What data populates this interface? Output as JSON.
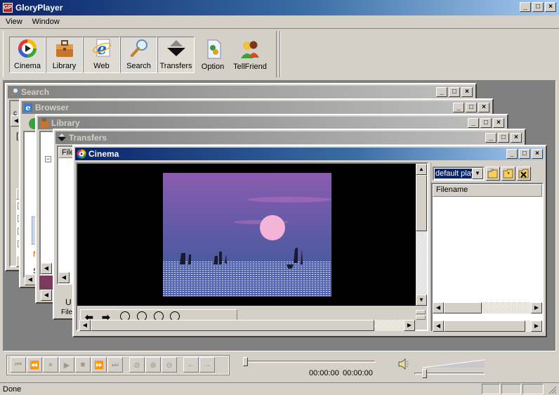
{
  "app": {
    "title": "GloryPlayer",
    "window_controls": {
      "minimize": "_",
      "maximize": "□",
      "close": "×"
    }
  },
  "menu": {
    "items": [
      {
        "label": "View",
        "accel": "V"
      },
      {
        "label": "Window",
        "accel": "W"
      }
    ]
  },
  "toolbar": {
    "buttons": [
      {
        "label": "Cinema",
        "icon": "cinema-icon",
        "pressed": true
      },
      {
        "label": "Library",
        "icon": "briefcase-icon",
        "pressed": true
      },
      {
        "label": "Web",
        "icon": "ie-icon",
        "pressed": true
      },
      {
        "label": "Search",
        "icon": "magnifier-icon",
        "pressed": true
      },
      {
        "label": "Transfers",
        "icon": "transfers-icon",
        "pressed": true
      },
      {
        "label": "Option",
        "icon": "option-icon",
        "pressed": false
      },
      {
        "label": "TellFriend",
        "icon": "users-icon",
        "pressed": false
      }
    ]
  },
  "child_windows": {
    "search": {
      "title": "Search",
      "partial_texts": [
        "c",
        "[F",
        "F",
        "M",
        "S"
      ]
    },
    "browser": {
      "title": "Browser"
    },
    "library": {
      "title": "Library",
      "tree_toggle": "−"
    },
    "transfers": {
      "title": "Transfers",
      "header_file": "File",
      "partial_u": "U",
      "partial_file2": "File"
    },
    "cinema": {
      "title": "Cinema",
      "playlist_selected": "default play",
      "list_header": "Filename",
      "playlist_buttons": [
        "open-folder-icon",
        "new-playlist-icon",
        "delete-playlist-icon"
      ],
      "nav_buttons": [
        "back-arrow-icon",
        "forward-arrow-icon",
        "zoom-out-icon",
        "zoom-in-icon",
        "no-zoom-icon",
        "fit-icon"
      ],
      "video_scrollbar_position": 0.0
    }
  },
  "controls": {
    "transport": [
      "skip-start-icon",
      "rewind-icon",
      "pause-icon",
      "play-icon",
      "stop-icon",
      "fast-forward-icon",
      "skip-end-icon"
    ],
    "zoom": [
      "zoom-reset-icon",
      "zoom-in-icon",
      "zoom-out-icon"
    ],
    "nav": [
      "back-icon",
      "forward-icon"
    ],
    "seek_position": 0.0,
    "time_elapsed": "00:00:00",
    "time_total": "00:00:00",
    "volume_level": 0.12
  },
  "status": {
    "text": "Done"
  }
}
